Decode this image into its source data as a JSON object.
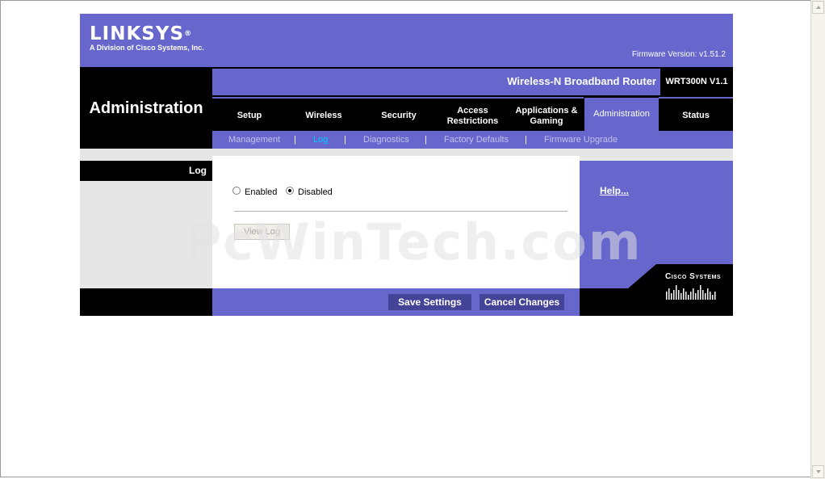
{
  "header": {
    "brand": "LINKSYS",
    "registered": "®",
    "brand_sub": "A Division of Cisco Systems, Inc.",
    "firmware": "Firmware Version: v1.51.2",
    "product_name": "Wireless-N Broadband Router",
    "model": "WRT300N V1.1"
  },
  "section_title": "Administration",
  "tabs": [
    {
      "label": "Setup"
    },
    {
      "label": "Wireless"
    },
    {
      "label": "Security"
    },
    {
      "label": "Access\nRestrictions"
    },
    {
      "label": "Applications &\nGaming"
    },
    {
      "label": "Administration"
    },
    {
      "label": "Status"
    }
  ],
  "subnav": {
    "items": [
      "Management",
      "Log",
      "Diagnostics",
      "Factory Defaults",
      "Firmware Upgrade"
    ],
    "separator": "|",
    "active": "Log"
  },
  "left_label": "Log",
  "log_form": {
    "enabled_label": "Enabled",
    "disabled_label": "Disabled",
    "selected": "Disabled",
    "view_log_button": "View Log"
  },
  "help_link": "Help...",
  "buttons": {
    "save": "Save Settings",
    "cancel": "Cancel Changes"
  },
  "footer_logo": "Cisco Systems",
  "watermark": "PcWinTech.com",
  "colors": {
    "primary": "#6666cc",
    "black": "#000000",
    "button": "#434398",
    "active_subnav": "#00ccff"
  }
}
